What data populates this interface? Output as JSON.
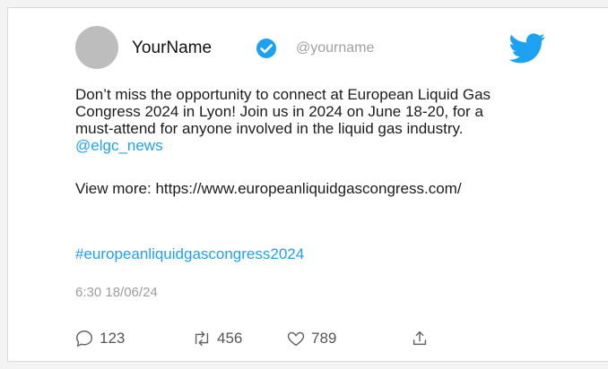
{
  "profile": {
    "name": "YourName",
    "handle": "@yourname"
  },
  "tweet": {
    "line1": "Don’t miss the opportunity to connect at European Liquid Gas Congress 2024 in Lyon!  Join us in 2024 on June 18-20, for a must-attend for anyone involved in the liquid gas industry.",
    "mention": "@elgc_news",
    "view_more": "View more: https://www.europeanliquidgascongress.com/",
    "hashtag": "#europeanliquidgascongress2024",
    "timestamp": "6:30 18/06/24"
  },
  "actions": {
    "replies": "123",
    "retweets": "456",
    "likes": "789"
  },
  "icons": {
    "verified": "verified-badge-icon",
    "brand": "twitter-bird-icon",
    "reply": "reply-icon",
    "retweet": "retweet-icon",
    "like": "heart-icon",
    "share": "share-icon"
  },
  "colors": {
    "accent": "#1da1f2",
    "avatar": "#bdbdbd",
    "muted": "#9e9e9e"
  }
}
